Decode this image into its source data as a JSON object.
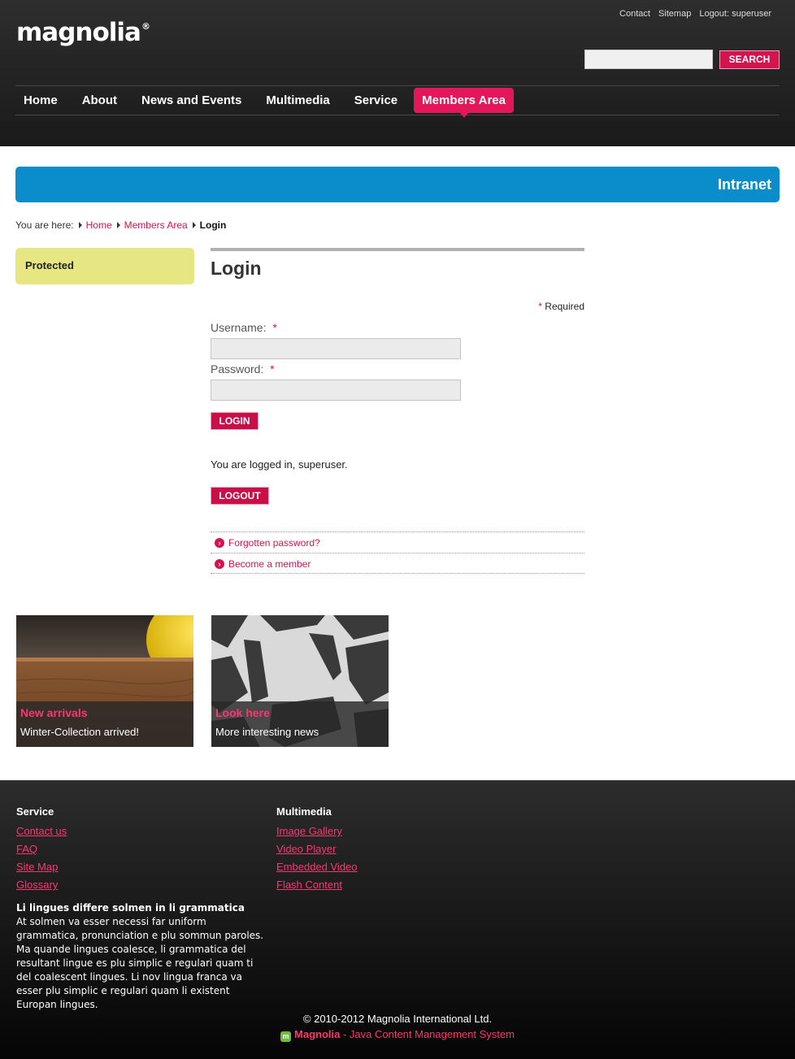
{
  "header": {
    "logo_text": "magnolia",
    "logo_mark": "®",
    "meta_nav": [
      "Contact",
      "Sitemap",
      "Logout: superuser"
    ],
    "search": {
      "placeholder": "",
      "button_label": "SEARCH"
    },
    "nav": [
      "Home",
      "About",
      "News and Events",
      "Multimedia",
      "Service",
      "Members Area"
    ],
    "active_nav": "Members Area"
  },
  "banner": {
    "title": "Intranet",
    "color": "#0b8ccb"
  },
  "breadcrumb": {
    "prefix": "You are here:",
    "links": [
      "Home",
      "Members Area"
    ],
    "current": "Login"
  },
  "sidebar": {
    "protected_label": "Protected"
  },
  "login": {
    "title": "Login",
    "required_star": "*",
    "required_label": "Required",
    "username_label": "Username:",
    "password_label": "Password:",
    "login_button": "LOGIN",
    "status_message": "You are logged in, superuser.",
    "logout_button": "LOGOUT",
    "links": [
      "Forgotten password?",
      "Become a member"
    ]
  },
  "teasers": [
    {
      "title": "New arrivals",
      "text": "Winter-Collection arrived!"
    },
    {
      "title": "Look here",
      "text": "More interesting news"
    }
  ],
  "footer": {
    "columns": [
      {
        "heading": "Service",
        "links": [
          "Contact us",
          "FAQ",
          "Site Map",
          "Glossary"
        ]
      },
      {
        "heading": "Multimedia",
        "links": [
          "Image Gallery",
          "Video Player",
          "Embedded Video",
          "Flash Content"
        ]
      }
    ],
    "text_title": "Li lingues differe solmen in li grammatica",
    "text_body": "At solmen va esser necessi far uniform grammatica, pronunciation e plu sommun paroles. Ma quande lingues coalesce, li grammatica del resultant lingue es plu simplic e regulari quam ti del coalescent lingues. Li nov lingua franca va esser plu simplic e regulari quam li existent Europan lingues.",
    "copyright": "© 2010-2012 Magnolia International Ltd.",
    "powered_brand": "Magnolia",
    "powered_suffix": " - Java Content Management System"
  },
  "colors": {
    "accent": "#d4144f",
    "nav_active": "#e3175a",
    "protected_bg": "#e6e682"
  },
  "icons": [
    "arrow-circle-icon",
    "magnolia-icon",
    "breadcrumb-arrow-icon"
  ]
}
